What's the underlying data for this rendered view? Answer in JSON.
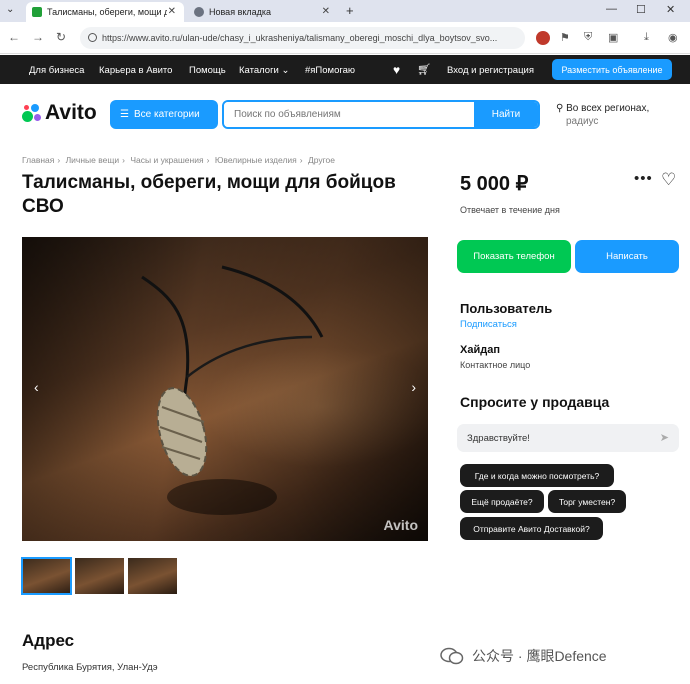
{
  "browser": {
    "tabs": [
      {
        "label": "Талисманы, обереги, мощи д",
        "active": true
      },
      {
        "label": "Новая вкладка",
        "active": false
      }
    ],
    "new_tab": "+",
    "url": "https://www.avito.ru/ulan-ude/chasy_i_ukrasheniya/talismany_oberegi_moschi_dlya_boytsov_svo..."
  },
  "topnav": {
    "items": [
      "Для бизнеса",
      "Карьера в Авито",
      "Помощь",
      "Каталоги",
      "#яПомогаю"
    ],
    "login": "Вход и регистрация",
    "post_ad": "Разместить объявление"
  },
  "header": {
    "logo": "Avito",
    "categories": "Все категории",
    "search_placeholder": "Поиск по объявлениям",
    "search_button": "Найти",
    "region": "Во всех регионах,",
    "region_sub": "радиус"
  },
  "breadcrumbs": [
    "Главная",
    "Личные вещи",
    "Часы и украшения",
    "Ювелирные изделия",
    "Другое"
  ],
  "listing": {
    "title": "Талисманы, обереги, мощи для бойцов СВО",
    "price": "5 000 ₽",
    "reply_time": "Отвечает в течение дня",
    "photo_watermark": "Avito",
    "thumb_count": 3
  },
  "actions": {
    "show_phone": "Показать телефон",
    "write": "Написать"
  },
  "seller": {
    "name": "Пользователь",
    "subscribe": "Подписаться",
    "contact_name": "Хайдап",
    "contact_role": "Контактное лицо"
  },
  "ask": {
    "heading": "Спросите у продавца",
    "input_value": "Здравствуйте!",
    "chips": [
      "Где и когда можно посмотреть?",
      "Ещё продаёте?",
      "Торг уместен?",
      "Отправите Авито Доставкой?"
    ]
  },
  "address": {
    "heading": "Адрес",
    "value": "Республика Бурятия, Улан-Удэ"
  },
  "watermark": "公众号 · 鹰眼Defence",
  "colors": {
    "accent": "#1a9bff",
    "green": "#00c853",
    "dark": "#1c1c1c"
  }
}
